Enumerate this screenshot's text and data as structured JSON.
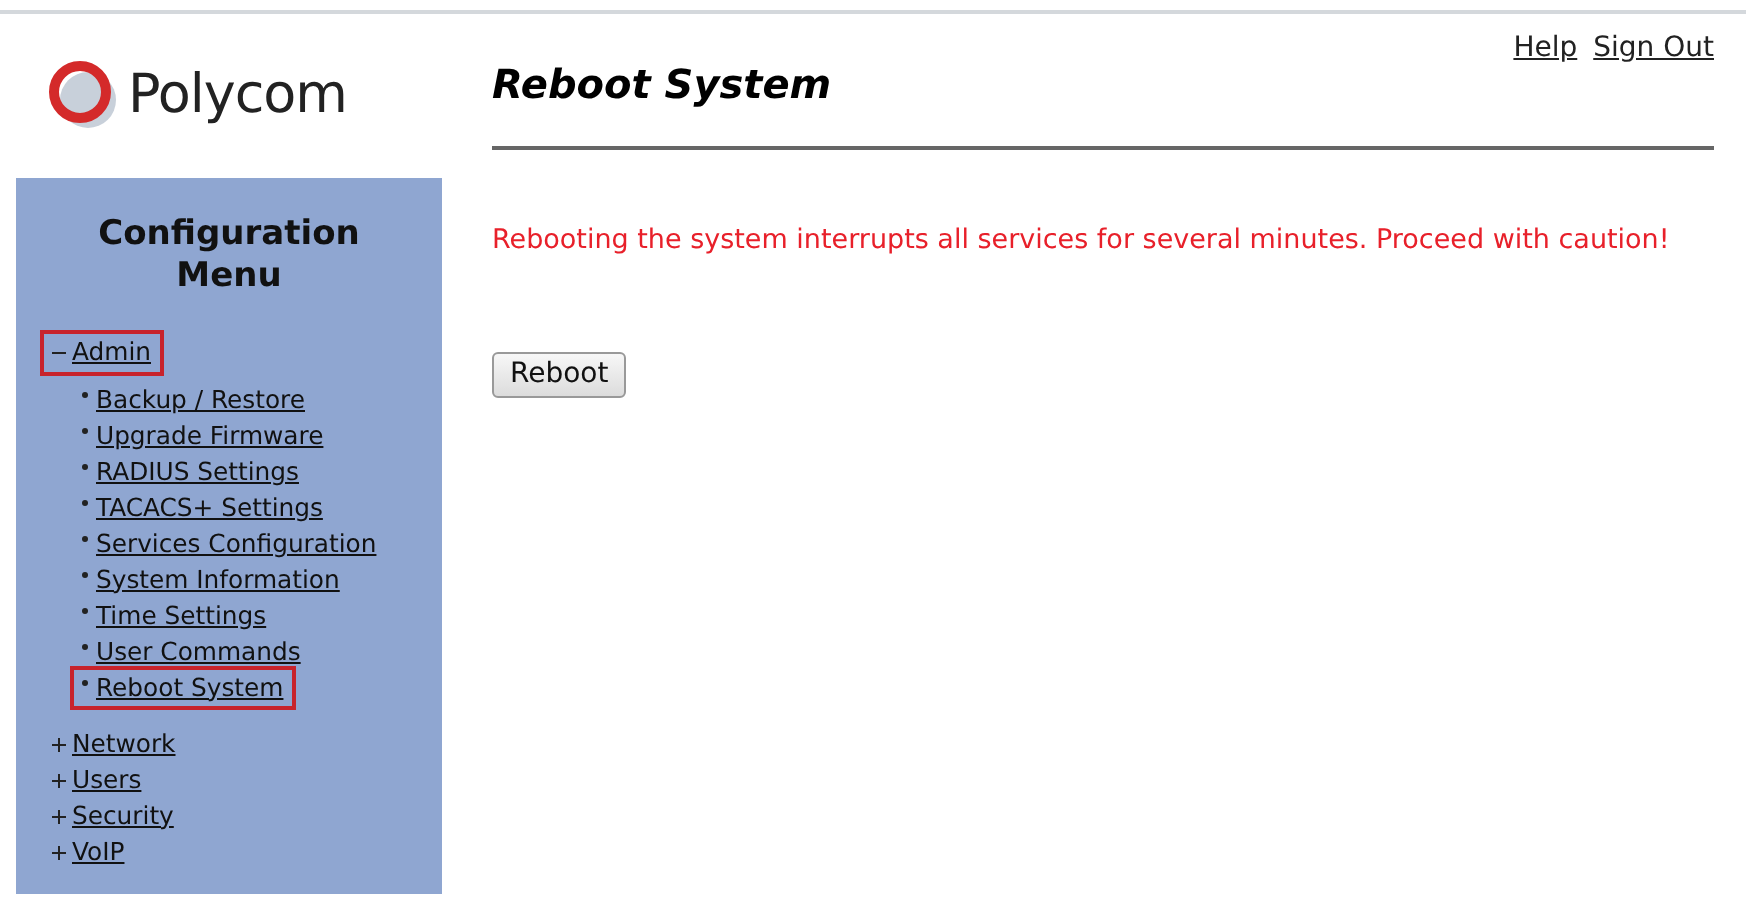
{
  "logo": {
    "text": "Polycom"
  },
  "sidebar": {
    "title": "Configuration Menu",
    "sections": [
      {
        "label": "Admin",
        "expanded": true,
        "highlighted": true,
        "children": [
          {
            "label": "Backup / Restore",
            "highlighted": false
          },
          {
            "label": "Upgrade Firmware",
            "highlighted": false
          },
          {
            "label": "RADIUS Settings",
            "highlighted": false
          },
          {
            "label": "TACACS+ Settings",
            "highlighted": false
          },
          {
            "label": "Services Configuration",
            "highlighted": false
          },
          {
            "label": "System Information",
            "highlighted": false
          },
          {
            "label": "Time Settings",
            "highlighted": false
          },
          {
            "label": "User Commands",
            "highlighted": false
          },
          {
            "label": "Reboot System",
            "highlighted": true
          }
        ]
      },
      {
        "label": "Network",
        "expanded": false,
        "highlighted": false
      },
      {
        "label": "Users",
        "expanded": false,
        "highlighted": false
      },
      {
        "label": "Security",
        "expanded": false,
        "highlighted": false
      },
      {
        "label": "VoIP",
        "expanded": false,
        "highlighted": false
      }
    ]
  },
  "header_links": [
    "Help",
    "Sign Out"
  ],
  "page_title": "Reboot System",
  "warning": "Rebooting the system interrupts all services for several minutes. Proceed with caution!",
  "buttons": [
    "Reboot"
  ]
}
